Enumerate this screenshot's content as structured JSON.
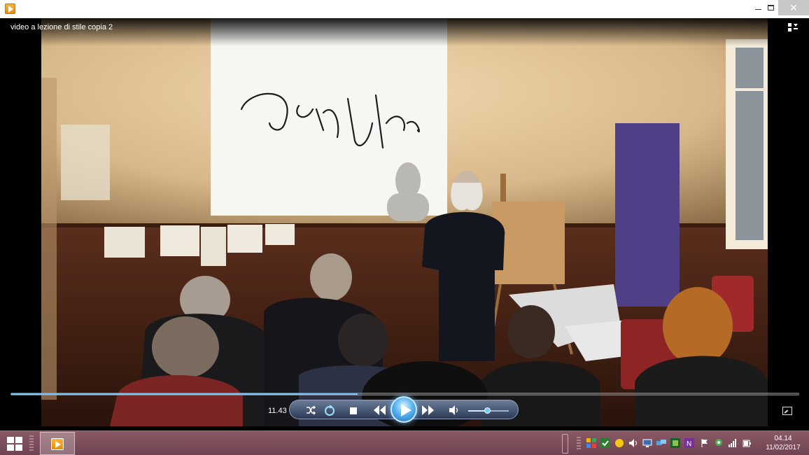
{
  "window": {
    "title": "video a lezione di stile copia 2"
  },
  "player": {
    "time": "11.43",
    "progress": 0.44,
    "volume": 0.5
  },
  "projection": {
    "signature": "Donghi Lurker"
  },
  "colors": {
    "accent": "#6fc6ff",
    "taskbar": "#7a4f5b"
  },
  "icons": {
    "repeat": "repeat-icon",
    "shuffle": "shuffle-icon",
    "stop": "stop-icon",
    "previous": "rewind-icon",
    "next": "fast-forward-icon",
    "volume": "speaker-icon"
  },
  "taskbar": {
    "clock_time": "04.14",
    "clock_date": "11/02/2017"
  }
}
